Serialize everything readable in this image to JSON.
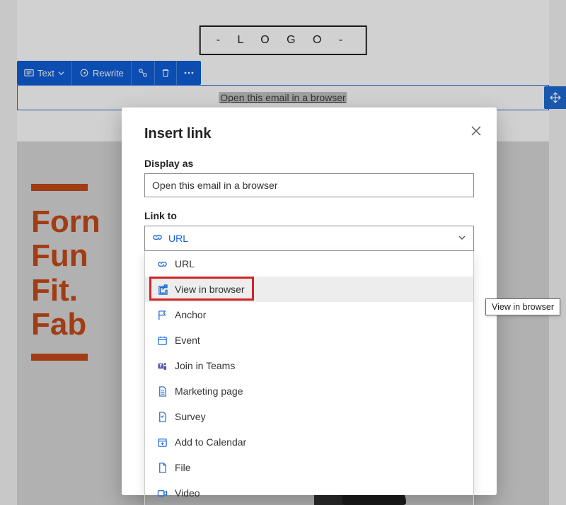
{
  "background": {
    "logo_text": "-  L  O  G  O  -",
    "toolbar": {
      "text_btn": "Text",
      "rewrite_btn": "Rewrite"
    },
    "selected_text": "Open this email in a browser",
    "hero_lines": [
      "Forn",
      "Fun",
      "Fit.",
      "Fab"
    ]
  },
  "modal": {
    "title": "Insert link",
    "display_as_label": "Display as",
    "display_as_value": "Open this email in a browser",
    "link_to_label": "Link to",
    "link_to_selected": "URL",
    "options": [
      {
        "id": "url",
        "label": "URL"
      },
      {
        "id": "view-in-browser",
        "label": "View in browser"
      },
      {
        "id": "anchor",
        "label": "Anchor"
      },
      {
        "id": "event",
        "label": "Event"
      },
      {
        "id": "join-in-teams",
        "label": "Join in Teams"
      },
      {
        "id": "marketing-page",
        "label": "Marketing page"
      },
      {
        "id": "survey",
        "label": "Survey"
      },
      {
        "id": "add-to-calendar",
        "label": "Add to Calendar"
      },
      {
        "id": "file",
        "label": "File"
      },
      {
        "id": "video",
        "label": "Video"
      }
    ]
  },
  "tooltip": "View in browser"
}
